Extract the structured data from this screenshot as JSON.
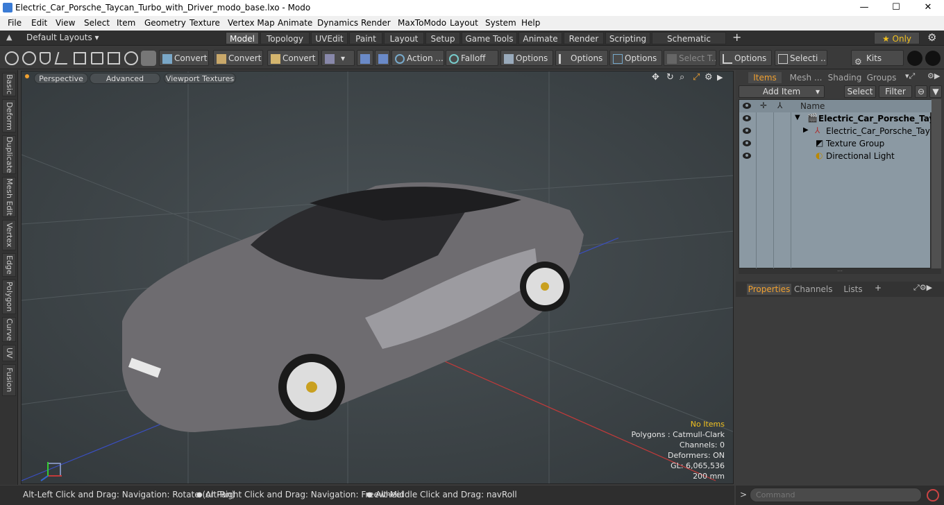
{
  "window": {
    "title": "Electric_Car_Porsche_Taycan_Turbo_with_Driver_modo_base.lxo - Modo",
    "min": "—",
    "max": "☐",
    "close": "✕"
  },
  "menu": [
    "File",
    "Edit",
    "View",
    "Select",
    "Item",
    "Geometry",
    "Texture",
    "Vertex Map",
    "Animate",
    "Dynamics",
    "Render",
    "MaxToModo",
    "Layout",
    "System",
    "Help"
  ],
  "layouts": {
    "dropdown": "Default Layouts ▾",
    "tabs": [
      "Model",
      "Topology",
      "UVEdit",
      "Paint",
      "Layout",
      "Setup",
      "Game Tools",
      "Animate",
      "Render",
      "Scripting",
      "Schematic Fusion"
    ],
    "active": "Model",
    "add": "+",
    "only": "★  Only",
    "gear": "⚙"
  },
  "toolbar": {
    "convert1": "Convert",
    "convert2": "Convert",
    "convert3": "Convert",
    "action": "Action ...",
    "falloff": "Falloff",
    "options1": "Options",
    "options2": "Options",
    "options3": "Options",
    "select_t": "Select T...",
    "options4": "Options",
    "selecti": "Selecti ...",
    "kits": "Kits"
  },
  "lefttabs": [
    "Basic",
    "Deform",
    "Duplicate",
    "Mesh Edit",
    "Vertex",
    "Edge",
    "Polygon",
    "Curve",
    "UV",
    "Fusion"
  ],
  "viewport": {
    "view_mode": "Perspective",
    "advanced": "Advanced",
    "textures": "Viewport Textures",
    "hud": {
      "selection": "No Items",
      "polygons": "Polygons : Catmull-Clark",
      "channels": "Channels: 0",
      "deformers": "Deformers: ON",
      "gl": "GL: 6,065,536",
      "scale": "200 mm"
    },
    "colors": {
      "grid_x": "#c23a3a",
      "grid_z": "#3a4fc2",
      "car_body": "#6e6c70",
      "hud_highlight": "#f0c020"
    }
  },
  "status": {
    "hint1": "Alt-Left Click and Drag: Navigation: Rotate (or Pan)",
    "hint2": "Alt-Right Click and Drag: Navigation: Freewheel",
    "hint3": "Alt-Middle Click and Drag: navRoll",
    "bullet": "●"
  },
  "items_panel": {
    "tabs": [
      "Items",
      "Mesh ...",
      "Shading",
      "Groups"
    ],
    "active": "Items",
    "add_item": "Add Item",
    "select": "Select",
    "filter": "Filter",
    "name_header": "Name",
    "rows": [
      {
        "label": "Electric_Car_Porsche_Tay...",
        "bold": true
      },
      {
        "label": "Electric_Car_Porsche_Tayca ...",
        "bold": false
      },
      {
        "label": "Texture Group",
        "bold": false
      },
      {
        "label": "Directional Light",
        "bold": false
      }
    ]
  },
  "props_panel": {
    "tabs": [
      "Properties",
      "Channels",
      "Lists"
    ],
    "active": "Properties",
    "add": "+"
  },
  "command": {
    "prompt": ">",
    "placeholder": "Command"
  }
}
